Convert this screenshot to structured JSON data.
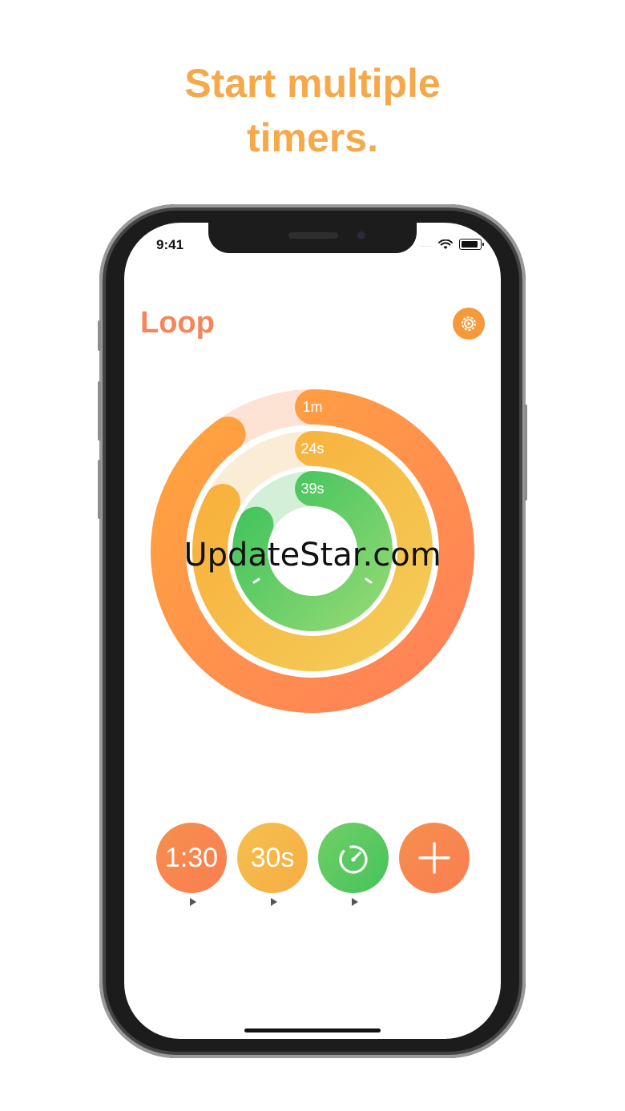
{
  "headline": {
    "line1": "Start multiple",
    "line2": "timers."
  },
  "status_bar": {
    "time": "9:41",
    "signal_dots": "....",
    "wifi_icon": "wifi-icon",
    "battery_icon": "battery-icon"
  },
  "app": {
    "title": "Loop",
    "settings_icon": "gear-icon"
  },
  "rings": {
    "outer": {
      "label": "1m",
      "progress": 0.9,
      "color_start": "#ff8c55",
      "color_end": "#ffa540",
      "track": "#fde3d4"
    },
    "middle": {
      "label": "24s",
      "progress": 0.83,
      "color_start": "#f3c44f",
      "color_end": "#f9b43a",
      "track": "#fbecd5"
    },
    "inner": {
      "label": "39s",
      "progress": 0.82,
      "color_start": "#7ed46c",
      "color_end": "#40c45a",
      "track": "#d3efd8"
    }
  },
  "watermark": "UpdateStar.com",
  "controls": [
    {
      "label": "1:30",
      "color": "#f8844e",
      "icon": "play-icon"
    },
    {
      "label": "30s",
      "color": "#f6b649",
      "icon": "play-icon"
    },
    {
      "label": "",
      "color": "#56c765",
      "icon": "stopwatch-icon"
    },
    {
      "label": "",
      "color": "#f8844e",
      "icon": "plus-icon"
    }
  ],
  "colors": {
    "headline": "#f5a94a",
    "title": "#f5855a",
    "settings": "#f59a3a"
  }
}
